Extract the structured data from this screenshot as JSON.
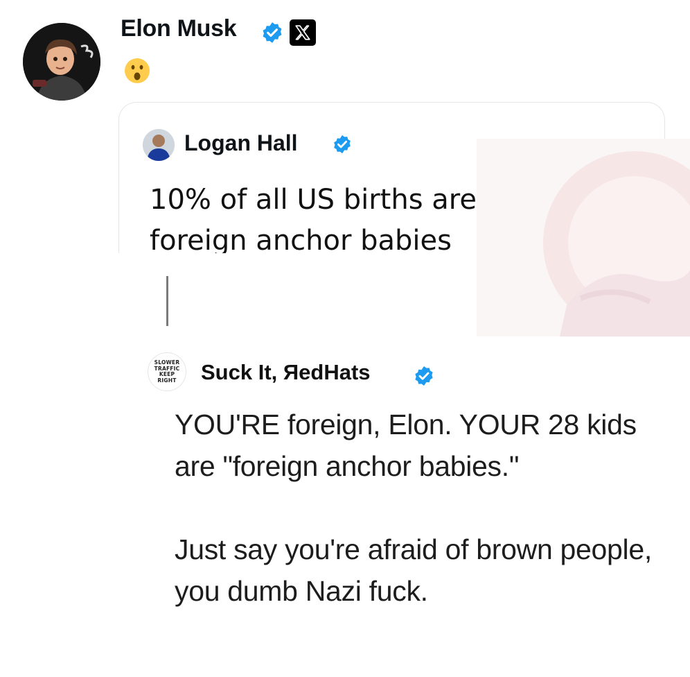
{
  "post": {
    "author": {
      "name": "Elon Musk",
      "verified_icon": "verified-badge-icon",
      "platform_icon": "x-logo-icon",
      "avatar_icon": "cartoon-avatar"
    },
    "body_emoji": "😮",
    "emoji_icon": "surprised-face-emoji"
  },
  "quoted": {
    "author": {
      "name": "Logan Hall",
      "verified_icon": "verified-badge-icon",
      "avatar_icon": "profile-photo"
    },
    "text": "10% of all US births are\nforeign anchor babies"
  },
  "reply": {
    "author": {
      "name": "Suck It, ЯedHats",
      "verified_icon": "verified-badge-icon",
      "avatar_lines": [
        "SLOWER",
        "TRAFFIC",
        "KEEP",
        "RIGHT"
      ]
    },
    "paragraphs": [
      "YOU'RE foreign, Elon. YOUR 28 kids are \"foreign anchor babies.\"",
      "Just say you're afraid of brown people, you dumb Nazi fuck."
    ]
  },
  "colors": {
    "verified_blue": "#1d9bf0",
    "text": "#0f1419",
    "border": "#e3e6e9",
    "thread_line": "#7a7a7a"
  }
}
